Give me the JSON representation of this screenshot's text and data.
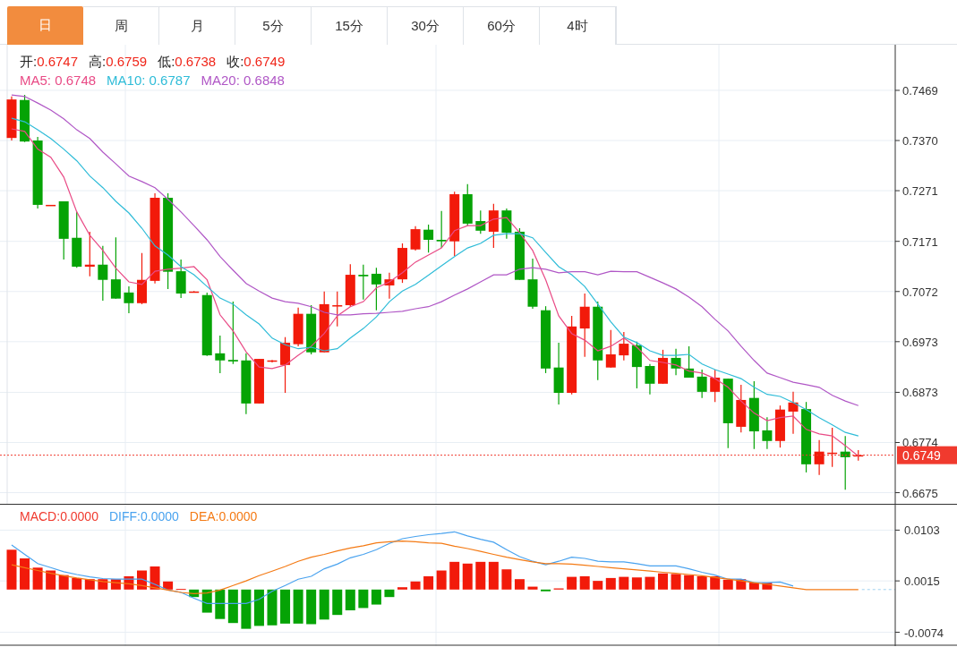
{
  "tabs": [
    {
      "label": "日",
      "selected": true
    },
    {
      "label": "周",
      "selected": false
    },
    {
      "label": "月",
      "selected": false
    },
    {
      "label": "5分",
      "selected": false
    },
    {
      "label": "15分",
      "selected": false
    },
    {
      "label": "30分",
      "selected": false
    },
    {
      "label": "60分",
      "selected": false
    },
    {
      "label": "4时",
      "selected": false
    }
  ],
  "quote": [
    {
      "label": "开:",
      "value": "0.6747"
    },
    {
      "label": "高:",
      "value": "0.6759"
    },
    {
      "label": "低:",
      "value": "0.6738"
    },
    {
      "label": "收:",
      "value": "0.6749"
    }
  ],
  "ma_legend": [
    {
      "label": "MA5:",
      "value": "0.6748",
      "color": "#e94b86"
    },
    {
      "label": "MA10:",
      "value": "0.6787",
      "color": "#2fbcd8"
    },
    {
      "label": "MA20:",
      "value": "0.6848",
      "color": "#b057c6"
    }
  ],
  "kline": {
    "chart_data": {
      "type": "candlestick",
      "grid": true,
      "ylim": [
        0.6653,
        0.7559
      ],
      "yticks": [
        {
          "value": 0.7469,
          "label": "0.7469"
        },
        {
          "value": 0.737,
          "label": "0.7370"
        },
        {
          "value": 0.7271,
          "label": "0.7271"
        },
        {
          "value": 0.7171,
          "label": "0.7171"
        },
        {
          "value": 0.7072,
          "label": "0.7072"
        },
        {
          "value": 0.6973,
          "label": "0.6973"
        },
        {
          "value": 0.6873,
          "label": "0.6873"
        },
        {
          "value": 0.6774,
          "label": "0.6774"
        },
        {
          "value": 0.6675,
          "label": "0.6675"
        }
      ],
      "ref_lines": [
        {
          "axis": "y",
          "value": 0.6749,
          "label": "0.6749",
          "color": "#f03a2e"
        }
      ],
      "ohlc": [
        [
          0.7375,
          0.7457,
          0.737,
          0.7451
        ],
        [
          0.745,
          0.746,
          0.7367,
          0.7368
        ],
        [
          0.737,
          0.7377,
          0.7236,
          0.7243
        ],
        [
          0.7241,
          0.7243,
          0.7241,
          0.7243
        ],
        [
          0.725,
          0.725,
          0.7135,
          0.7176
        ],
        [
          0.7178,
          0.7229,
          0.7119,
          0.7121
        ],
        [
          0.7121,
          0.719,
          0.7102,
          0.7125
        ],
        [
          0.7125,
          0.7162,
          0.7054,
          0.7095
        ],
        [
          0.7096,
          0.7179,
          0.7058,
          0.7058
        ],
        [
          0.707,
          0.7082,
          0.7029,
          0.7049
        ],
        [
          0.7049,
          0.7148,
          0.7047,
          0.7095
        ],
        [
          0.7093,
          0.7266,
          0.7088,
          0.7257
        ],
        [
          0.7257,
          0.7266,
          0.7077,
          0.7111
        ],
        [
          0.7112,
          0.7135,
          0.7059,
          0.7068
        ],
        [
          0.707,
          0.7073,
          0.707,
          0.7072
        ],
        [
          0.7065,
          0.707,
          0.6945,
          0.6946
        ],
        [
          0.695,
          0.6985,
          0.6911,
          0.6936
        ],
        [
          0.6937,
          0.7052,
          0.6929,
          0.6934
        ],
        [
          0.6936,
          0.695,
          0.683,
          0.6851
        ],
        [
          0.6851,
          0.6939,
          0.6851,
          0.6939
        ],
        [
          0.6934,
          0.6937,
          0.6932,
          0.6936
        ],
        [
          0.6927,
          0.6982,
          0.6872,
          0.6971
        ],
        [
          0.6968,
          0.704,
          0.6964,
          0.7028
        ],
        [
          0.7028,
          0.7045,
          0.6948,
          0.6952
        ],
        [
          0.6952,
          0.7072,
          0.6952,
          0.7047
        ],
        [
          0.7043,
          0.7072,
          0.7003,
          0.7045
        ],
        [
          0.7045,
          0.7126,
          0.7042,
          0.7105
        ],
        [
          0.7105,
          0.7125,
          0.7056,
          0.7102
        ],
        [
          0.7107,
          0.7119,
          0.7035,
          0.7086
        ],
        [
          0.7084,
          0.7109,
          0.7058,
          0.7096
        ],
        [
          0.7096,
          0.7167,
          0.7089,
          0.7158
        ],
        [
          0.7155,
          0.7201,
          0.7153,
          0.7195
        ],
        [
          0.7194,
          0.7204,
          0.7149,
          0.7174
        ],
        [
          0.7174,
          0.7231,
          0.7158,
          0.7171
        ],
        [
          0.7171,
          0.7269,
          0.7142,
          0.7264
        ],
        [
          0.7264,
          0.7284,
          0.7202,
          0.7206
        ],
        [
          0.7211,
          0.7232,
          0.7186,
          0.7192
        ],
        [
          0.719,
          0.7245,
          0.7158,
          0.7232
        ],
        [
          0.7232,
          0.7236,
          0.7176,
          0.7188
        ],
        [
          0.719,
          0.7197,
          0.7095,
          0.7095
        ],
        [
          0.7096,
          0.7137,
          0.7038,
          0.7042
        ],
        [
          0.7035,
          0.7043,
          0.6911,
          0.692
        ],
        [
          0.6922,
          0.6971,
          0.6849,
          0.6872
        ],
        [
          0.6872,
          0.7024,
          0.6869,
          0.7003
        ],
        [
          0.6999,
          0.7068,
          0.6943,
          0.7042
        ],
        [
          0.7042,
          0.7052,
          0.6897,
          0.6936
        ],
        [
          0.6922,
          0.6996,
          0.6922,
          0.6948
        ],
        [
          0.6946,
          0.6992,
          0.6936,
          0.6969
        ],
        [
          0.6966,
          0.6973,
          0.6881,
          0.6923
        ],
        [
          0.6925,
          0.6929,
          0.6869,
          0.689
        ],
        [
          0.689,
          0.6957,
          0.689,
          0.6941
        ],
        [
          0.6941,
          0.6959,
          0.6907,
          0.692
        ],
        [
          0.692,
          0.6964,
          0.6902,
          0.6902
        ],
        [
          0.6904,
          0.6918,
          0.6862,
          0.6874
        ],
        [
          0.6874,
          0.6918,
          0.6854,
          0.6902
        ],
        [
          0.69,
          0.69,
          0.6763,
          0.6812
        ],
        [
          0.6805,
          0.6888,
          0.6794,
          0.6858
        ],
        [
          0.6862,
          0.6895,
          0.6761,
          0.6796
        ],
        [
          0.6798,
          0.6824,
          0.6761,
          0.6777
        ],
        [
          0.6777,
          0.6847,
          0.6764,
          0.6839
        ],
        [
          0.6835,
          0.6874,
          0.6791,
          0.6853
        ],
        [
          0.684,
          0.6854,
          0.6715,
          0.6731
        ],
        [
          0.6731,
          0.6779,
          0.671,
          0.6756
        ],
        [
          0.6752,
          0.6803,
          0.6726,
          0.6754
        ],
        [
          0.6756,
          0.6787,
          0.6681,
          0.6745
        ],
        [
          0.6747,
          0.6759,
          0.6738,
          0.6749
        ]
      ],
      "series": [
        {
          "type": "line",
          "color": "#e94b86",
          "values": [
            0.7393,
            0.7388,
            0.7353,
            0.7337,
            0.7298,
            0.7229,
            0.7183,
            0.7153,
            0.7118,
            0.7091,
            0.7086,
            0.7112,
            0.7116,
            0.7118,
            0.7121,
            0.7095,
            0.7026,
            0.6994,
            0.6953,
            0.6923,
            0.692,
            0.6927,
            0.6946,
            0.6964,
            0.6989,
            0.7024,
            0.7042,
            0.7052,
            0.7079,
            0.7091,
            0.7109,
            0.713,
            0.7144,
            0.7158,
            0.7192,
            0.7202,
            0.7202,
            0.7215,
            0.7218,
            0.7188,
            0.7153,
            0.7095,
            0.7024,
            0.6989,
            0.6976,
            0.6955,
            0.6964,
            0.698,
            0.6962,
            0.6936,
            0.6932,
            0.6927,
            0.6915,
            0.6911,
            0.69,
            0.6883,
            0.6856,
            0.6832,
            0.6817,
            0.6823,
            0.6826,
            0.68,
            0.6791,
            0.6787,
            0.6768,
            0.6747
          ]
        },
        {
          "type": "line",
          "color": "#2fbcd8",
          "values": [
            0.7414,
            0.7407,
            0.7391,
            0.7374,
            0.7353,
            0.733,
            0.73,
            0.7277,
            0.725,
            0.7227,
            0.7197,
            0.7162,
            0.7144,
            0.7121,
            0.7105,
            0.7082,
            0.7059,
            0.7047,
            0.7026,
            0.7008,
            0.698,
            0.6967,
            0.6959,
            0.6962,
            0.6955,
            0.6959,
            0.698,
            0.6999,
            0.7022,
            0.7052,
            0.7073,
            0.7086,
            0.7104,
            0.7123,
            0.7141,
            0.7158,
            0.7167,
            0.7183,
            0.7186,
            0.7186,
            0.7178,
            0.7149,
            0.7121,
            0.7105,
            0.7082,
            0.7047,
            0.7012,
            0.6982,
            0.6971,
            0.6955,
            0.6946,
            0.6946,
            0.6948,
            0.6929,
            0.6918,
            0.6909,
            0.69,
            0.6883,
            0.6869,
            0.6865,
            0.6853,
            0.6839,
            0.6823,
            0.6809,
            0.6794,
            0.6787
          ]
        },
        {
          "type": "line",
          "color": "#b057c6",
          "values": [
            0.746,
            0.7457,
            0.7444,
            0.743,
            0.7413,
            0.7391,
            0.7374,
            0.7347,
            0.7324,
            0.73,
            0.7289,
            0.7277,
            0.7254,
            0.7229,
            0.7202,
            0.7174,
            0.7141,
            0.7114,
            0.7088,
            0.7073,
            0.7059,
            0.7052,
            0.7049,
            0.7042,
            0.7031,
            0.7026,
            0.7026,
            0.7028,
            0.7029,
            0.7031,
            0.7033,
            0.7038,
            0.7042,
            0.7052,
            0.7065,
            0.7077,
            0.7091,
            0.7105,
            0.7105,
            0.7116,
            0.7119,
            0.7116,
            0.7109,
            0.7111,
            0.7111,
            0.7105,
            0.7112,
            0.7111,
            0.7111,
            0.71,
            0.7089,
            0.7077,
            0.7061,
            0.7042,
            0.7017,
            0.6994,
            0.6964,
            0.6936,
            0.6911,
            0.6902,
            0.6893,
            0.6888,
            0.6883,
            0.6867,
            0.6856,
            0.6847
          ]
        }
      ]
    }
  },
  "macd": {
    "legend": [
      {
        "label": "MACD:",
        "value": "0.0000",
        "color": "#f03a2e"
      },
      {
        "label": "DIFF:",
        "value": "0.0000",
        "color": "#4aa3ef"
      },
      {
        "label": "DEA:",
        "value": "0.0000",
        "color": "#f47a14"
      }
    ],
    "chart_data": {
      "type": "bar",
      "grid": true,
      "ylim": [
        -0.0098,
        0.0147
      ],
      "yticks": [
        {
          "value": 0.0103,
          "label": "0.0103"
        },
        {
          "value": 0.0015,
          "label": "0.0015"
        },
        {
          "value": -0.0074,
          "label": "-0.0074"
        }
      ],
      "series": [
        {
          "type": "bar",
          "colors": [
            "#f21a0a",
            "#f21a0a",
            "#f21a0a",
            "#f21a0a",
            "#f21a0a",
            "#f21a0a",
            "#f21a0a",
            "#f21a0a",
            "#f21a0a",
            "#f21a0a",
            "#f21a0a",
            "#f21a0a",
            "#f21a0a",
            "#f21a0a",
            "#05a305",
            "#05a305",
            "#05a305",
            "#05a305",
            "#05a305",
            "#05a305",
            "#05a305",
            "#05a305",
            "#05a305",
            "#05a305",
            "#05a305",
            "#05a305",
            "#05a305",
            "#05a305",
            "#05a305",
            "#05a305",
            "#f21a0a",
            "#f21a0a",
            "#f21a0a",
            "#f21a0a",
            "#f21a0a",
            "#f21a0a",
            "#f21a0a",
            "#f21a0a",
            "#f21a0a",
            "#f21a0a",
            "#f21a0a",
            "#05a305",
            "#f21a0a",
            "#f21a0a",
            "#f21a0a",
            "#f21a0a",
            "#f21a0a",
            "#f21a0a",
            "#f21a0a",
            "#f21a0a",
            "#f21a0a",
            "#f21a0a",
            "#f21a0a",
            "#f21a0a",
            "#f21a0a",
            "#f21a0a",
            "#f21a0a",
            "#f21a0a",
            "#f21a0a",
            null,
            null,
            null,
            null,
            null,
            null,
            null
          ],
          "values": [
            0.0069,
            0.0054,
            0.0038,
            0.0033,
            0.0025,
            0.002,
            0.0018,
            0.0018,
            0.0018,
            0.0023,
            0.0033,
            0.004,
            0.0014,
            0.0001,
            -0.0013,
            -0.004,
            -0.0051,
            -0.0058,
            -0.0068,
            -0.0063,
            -0.0062,
            -0.0059,
            -0.0059,
            -0.006,
            -0.0052,
            -0.0044,
            -0.0036,
            -0.0032,
            -0.0026,
            -0.0013,
            0.0004,
            0.0014,
            0.0023,
            0.0033,
            0.0048,
            0.0045,
            0.0048,
            0.0048,
            0.0035,
            0.0018,
            0.0005,
            -0.0003,
            0.0002,
            0.0022,
            0.0023,
            0.0015,
            0.002,
            0.0022,
            0.0021,
            0.0022,
            0.0028,
            0.0027,
            0.0025,
            0.0023,
            0.0023,
            0.0017,
            0.0018,
            0.0012,
            0.0012,
            null,
            null,
            null,
            null,
            null,
            null,
            null
          ]
        },
        {
          "type": "line",
          "color": "#4aa3ef",
          "values": [
            0.0077,
            0.0061,
            0.0045,
            0.0038,
            0.0031,
            0.0026,
            0.0022,
            0.0019,
            0.0018,
            0.0018,
            0.0018,
            0.0009,
            -0.0001,
            -0.0005,
            -0.0015,
            -0.0024,
            -0.0024,
            -0.0024,
            -0.0024,
            -0.0017,
            -0.0003,
            0.0007,
            0.0018,
            0.0023,
            0.0036,
            0.0044,
            0.0055,
            0.0061,
            0.0069,
            0.008,
            0.0088,
            0.0092,
            0.0095,
            0.0097,
            0.01,
            0.0093,
            0.0087,
            0.0082,
            0.0069,
            0.0057,
            0.0049,
            0.0043,
            0.0049,
            0.0056,
            0.0054,
            0.0049,
            0.0048,
            0.0048,
            0.0045,
            0.0041,
            0.0041,
            0.0041,
            0.0036,
            0.003,
            0.0025,
            0.0018,
            0.0018,
            0.0012,
            0.0012,
            0.0013,
            0.0006,
            null,
            null,
            null,
            null,
            null
          ]
        },
        {
          "type": "line",
          "color": "#f47a14",
          "values": [
            0.0043,
            0.0038,
            0.0033,
            0.0028,
            0.0024,
            0.002,
            0.0017,
            0.0014,
            0.0012,
            0.001,
            0.0007,
            0.0003,
            -0.0001,
            -0.0005,
            -0.0007,
            -0.0006,
            -0.0001,
            0.0007,
            0.0015,
            0.0024,
            0.0032,
            0.004,
            0.0049,
            0.0056,
            0.0061,
            0.0067,
            0.0072,
            0.0076,
            0.0081,
            0.0083,
            0.0084,
            0.0083,
            0.0081,
            0.008,
            0.0075,
            0.0071,
            0.0066,
            0.0061,
            0.0056,
            0.0052,
            0.0048,
            0.0045,
            0.0045,
            0.0044,
            0.0042,
            0.004,
            0.0038,
            0.0036,
            0.0034,
            0.0032,
            0.003,
            0.0028,
            0.0026,
            0.0024,
            0.0021,
            0.0018,
            0.0015,
            0.0012,
            0.0009,
            0.0006,
            0.0003,
            0,
            0,
            0,
            0,
            0
          ]
        }
      ]
    }
  }
}
